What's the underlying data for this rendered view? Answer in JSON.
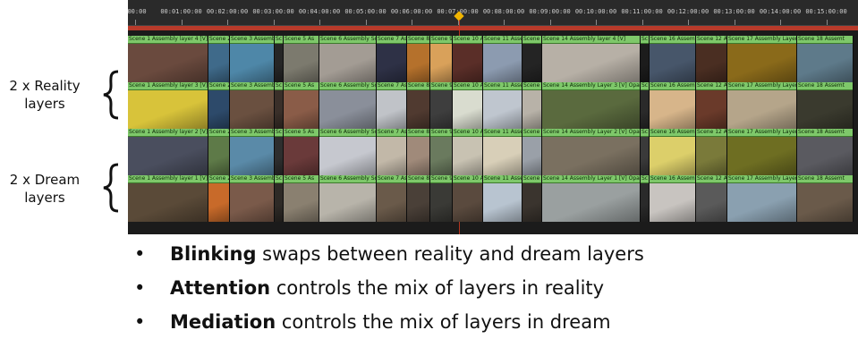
{
  "captions": {
    "reality": [
      "2 x Reality",
      "layers"
    ],
    "dream": [
      "2 x Dream",
      "layers"
    ]
  },
  "timeline": {
    "ruler_ticks": [
      "00:00",
      "00:01:00:00",
      "00:02:00:00",
      "00:03:00:00",
      "00:04:00:00",
      "00:05:00:00",
      "00:06:00:00",
      "00:07:00:00",
      "00:08:00:00",
      "00:09:00:00",
      "00:10:00:00",
      "00:11:00:00",
      "00:12:00:00",
      "00:13:00:00",
      "00:14:00:00",
      "00:15:00:00"
    ],
    "playhead_time": "00:07:00:00",
    "tracks": [
      {
        "name": "Assembly layer 4",
        "clips": [
          {
            "label": "Scene 1 Assembly layer 4 [V]",
            "color": "#6a4a3e"
          },
          {
            "label": "Scene 2",
            "color": "#3f6a8a"
          },
          {
            "label": "Scene 3 Assembly",
            "color": "#4e87a8"
          },
          {
            "label": "Sc",
            "color": "#262626"
          },
          {
            "label": "Scene 5 As",
            "color": "#7c7a6e"
          },
          {
            "label": "Scene 6 Assembly Sce",
            "color": "#a39c94"
          },
          {
            "label": "Scene 7 As",
            "color": "#2e3146"
          },
          {
            "label": "Scene 8",
            "color": "#b5712c"
          },
          {
            "label": "Scene 9",
            "color": "#d9a15a"
          },
          {
            "label": "Scene 10 A",
            "color": "#5a2e28"
          },
          {
            "label": "Scene 11 Assen",
            "color": "#8c9bb0"
          },
          {
            "label": "Scene 1",
            "color": "#242424"
          },
          {
            "label": "Scene 14 Assembly layer 4 [V]",
            "color": "#b7b0a6"
          },
          {
            "label": "Sc",
            "color": "#1c1c1c"
          },
          {
            "label": "Scene 16 Assem",
            "color": "#47566a"
          },
          {
            "label": "Scene 12 As",
            "color": "#4a2e22"
          },
          {
            "label": "Scene 17 Assembly Layer 4 [V]",
            "color": "#8a6a1a"
          },
          {
            "label": "Scene 18 Assemt",
            "color": "#5e7a8a"
          }
        ]
      },
      {
        "name": "Assembly layer 3",
        "clips": [
          {
            "label": "Scene 1 Assembly layer 3 [V] Op",
            "color": "#d8c33a"
          },
          {
            "label": "Scene 2",
            "color": "#2d4a6a"
          },
          {
            "label": "Scene 3 Assembl",
            "color": "#6a5040"
          },
          {
            "label": "Sc",
            "color": "#3a2f29"
          },
          {
            "label": "Scene 5 As",
            "color": "#8a5c48"
          },
          {
            "label": "Scene 6 Assembly Sce",
            "color": "#8a8f9a"
          },
          {
            "label": "Scene 7 As",
            "color": "#c0c3c8"
          },
          {
            "label": "Scene 8",
            "color": "#503a30"
          },
          {
            "label": "Scene 9",
            "color": "#3e3e3e"
          },
          {
            "label": "Scene 10 A",
            "color": "#d9dccf"
          },
          {
            "label": "Scene 11 Assen",
            "color": "#bfc6cf"
          },
          {
            "label": "Scene 1",
            "color": "#b8b2a8"
          },
          {
            "label": "Scene 14 Assembly Layer 3 [V] Opacity",
            "color": "#5a6a3e"
          },
          {
            "label": "Sc",
            "color": "#2a2a2a"
          },
          {
            "label": "Scene 16 Assem",
            "color": "#d7b58a"
          },
          {
            "label": "Scene 12 As",
            "color": "#6a3a2a"
          },
          {
            "label": "Scene 17 Assembly Layer 3 [V] Op",
            "color": "#b5a58a"
          },
          {
            "label": "Scene 18 Assemt",
            "color": "#3a3a2e"
          }
        ]
      },
      {
        "name": "Assembly layer 2",
        "clips": [
          {
            "label": "Scene 1 Assembly layer 2 [V] Op",
            "color": "#4a4e5e"
          },
          {
            "label": "Scene 2",
            "color": "#5e7a48"
          },
          {
            "label": "Scene 3 Assembl",
            "color": "#5a8aa8"
          },
          {
            "label": "Sc",
            "color": "#2e2e2e"
          },
          {
            "label": "Scene 5 As",
            "color": "#6a3a3a"
          },
          {
            "label": "Scene 6 Assembly Sce",
            "color": "#c6c8cf"
          },
          {
            "label": "Scene 7 Ass",
            "color": "#c2b8a8"
          },
          {
            "label": "Scene 8",
            "color": "#a08a7a"
          },
          {
            "label": "Scene 9",
            "color": "#6a7a5e"
          },
          {
            "label": "Scene 10 A",
            "color": "#c8c2b2"
          },
          {
            "label": "Scene 11 Assem",
            "color": "#d8cfb8"
          },
          {
            "label": "Scene 1",
            "color": "#9aa0a8"
          },
          {
            "label": "Scene 14 Assembly Layer 2 [V] Opacity",
            "color": "#7a7060"
          },
          {
            "label": "Sc",
            "color": "#3a3a3a"
          },
          {
            "label": "Scene 16 Assem",
            "color": "#dccf6a"
          },
          {
            "label": "Scene 12 As",
            "color": "#7a7a3a"
          },
          {
            "label": "Scene 17 Assembly Layer 2 [V] Op",
            "color": "#6e6e22"
          },
          {
            "label": "Scene 18 Assemt",
            "color": "#5a5a60"
          }
        ]
      },
      {
        "name": "Assembly layer 1",
        "clips": [
          {
            "label": "Scene 1 Assembly layer 1 [V] Op",
            "color": "#5a4a38"
          },
          {
            "label": "Scene 2",
            "color": "#c86a2a"
          },
          {
            "label": "Scene 3 Assembl",
            "color": "#7a5a4a"
          },
          {
            "label": "Sc",
            "color": "#2e2a26"
          },
          {
            "label": "Scene 5 As",
            "color": "#8a8070"
          },
          {
            "label": "Scene 6 Assembly Sce",
            "color": "#b8b4aa"
          },
          {
            "label": "Scene 7 Ass",
            "color": "#6a5a4a"
          },
          {
            "label": "Scene 8",
            "color": "#4a4038"
          },
          {
            "label": "Scene 9",
            "color": "#3a3a36"
          },
          {
            "label": "Scene 10 A",
            "color": "#5a4a3e"
          },
          {
            "label": "Scene 11 Assem",
            "color": "#b8c4d0"
          },
          {
            "label": "Scene 1",
            "color": "#3a342e"
          },
          {
            "label": "Scene 14 Assembly Layer 1 [V] Opacity",
            "color": "#9aa0a0"
          },
          {
            "label": "Sc",
            "color": "#2a2a2a"
          },
          {
            "label": "Scene 16 Assem",
            "color": "#c8c4c0"
          },
          {
            "label": "Scene 12 As",
            "color": "#5a5a5a"
          },
          {
            "label": "Scene 17 Assembly Layer 1 [V] Op",
            "color": "#8aa0b0"
          },
          {
            "label": "Scene 18 Assemt",
            "color": "#6a5a4a"
          }
        ]
      }
    ]
  },
  "bullets": [
    {
      "dot": "•",
      "bold": "Blinking",
      "rest": " swaps between reality and dream layers"
    },
    {
      "dot": "•",
      "bold": "Attention",
      "rest": " controls the mix of layers in reality"
    },
    {
      "dot": "•",
      "bold": "Mediation",
      "rest": " controls the mix of layers in dream"
    }
  ]
}
